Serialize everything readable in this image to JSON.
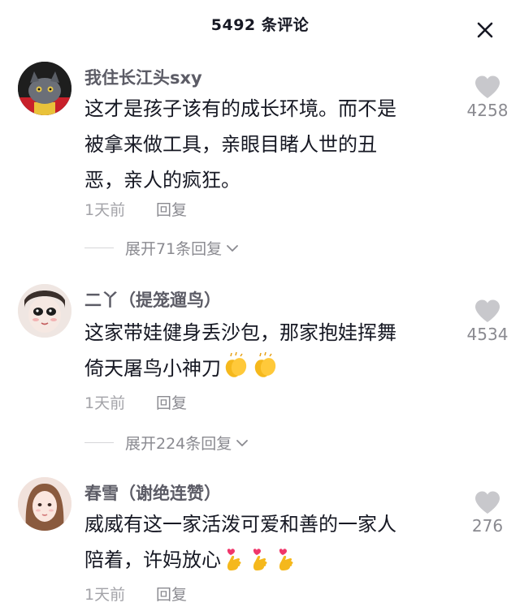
{
  "header": {
    "title": "5492 条评论",
    "close_icon": "close-icon"
  },
  "comments": [
    {
      "username": "我住长江头sxy",
      "lines": [
        "这才是孩子该有的成长环境。而不是",
        "被拿来做工具，亲眼目睹人世的丑",
        "恶，亲人的疯狂。"
      ],
      "time": "1天前",
      "reply_label": "回复",
      "likes": "4258",
      "expand_label": "展开71条回复",
      "avatar": "cat-avatar"
    },
    {
      "username": "二丫（提笼遛鸟）",
      "lines": [
        "这家带娃健身丢沙包，那家抱娃挥舞",
        "倚天屠鸟小神刀"
      ],
      "emojis": [
        "clapping-hands-emoji",
        "clapping-hands-emoji"
      ],
      "time": "1天前",
      "reply_label": "回复",
      "likes": "4534",
      "expand_label": "展开224条回复",
      "avatar": "cartoon-face-avatar"
    },
    {
      "username": "春雪（谢绝连赞）",
      "lines": [
        "威威有这一家活泼可爱和善的一家人",
        "陪着，许妈放心"
      ],
      "emojis": [
        "finger-heart-emoji",
        "finger-heart-emoji",
        "finger-heart-emoji"
      ],
      "time": "1天前",
      "reply_label": "回复",
      "likes": "276",
      "avatar": "girl-photo-avatar"
    }
  ],
  "colors": {
    "primary_text": "#161823",
    "username": "#5c5c66",
    "secondary": "#a3a3a8",
    "like_icon": "#c8c8cc"
  }
}
